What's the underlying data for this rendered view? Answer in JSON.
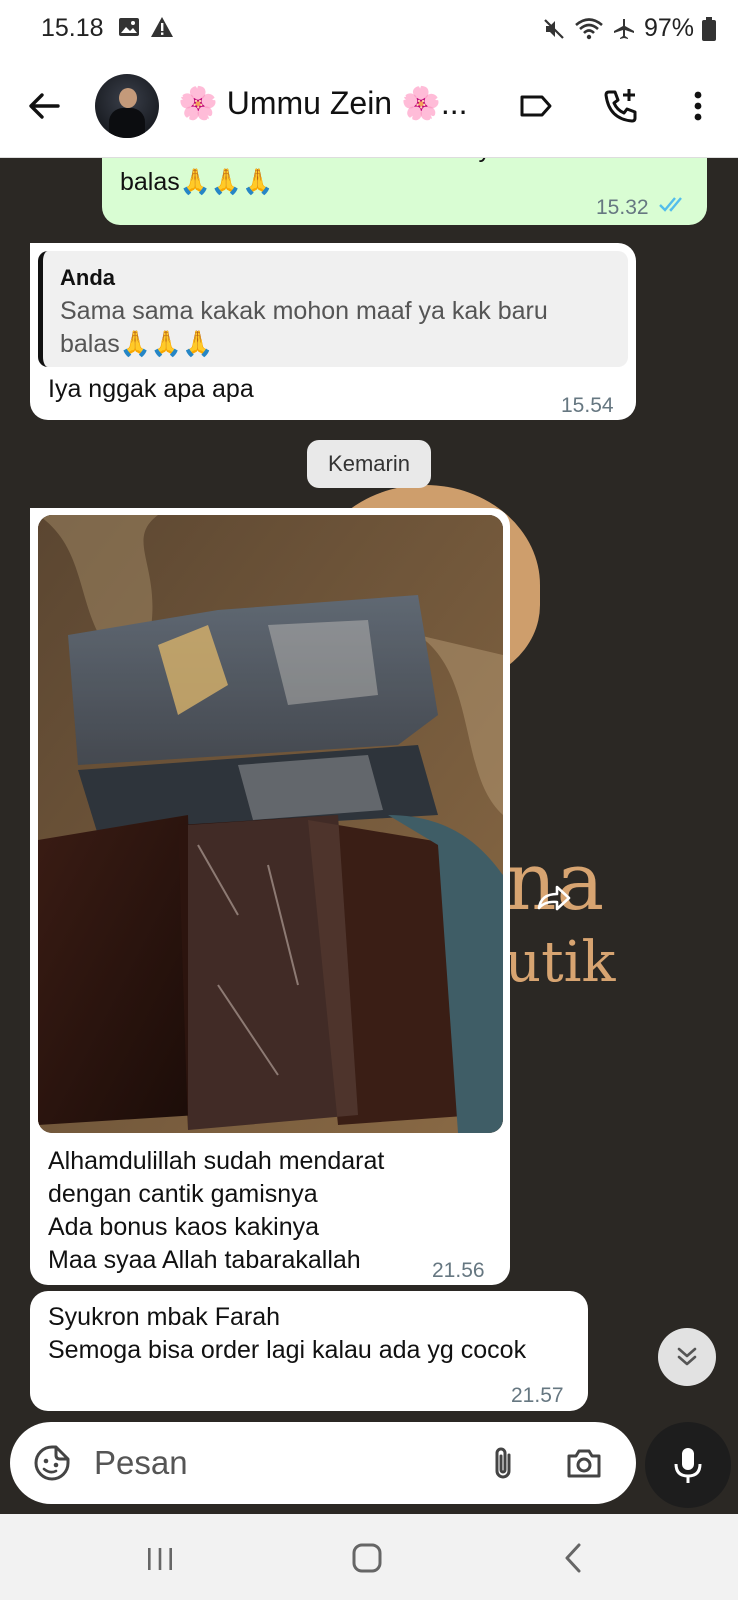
{
  "status_bar": {
    "time": "15.18",
    "battery": "97%"
  },
  "header": {
    "contact_name": "🌸 Ummu Zein 🌸..."
  },
  "messages": [
    {
      "direction": "out",
      "lines": [
        "Sama sama kakak mohon maaf ya kak baru",
        "balas🙏🙏🙏"
      ],
      "time": "15.32",
      "status": "read"
    },
    {
      "direction": "in",
      "quote_author": "Anda",
      "quote_lines": [
        "Sama sama kakak mohon maaf ya kak baru",
        "balas🙏🙏🙏"
      ],
      "text": "Iya nggak apa apa",
      "time": "15.54"
    },
    {
      "type": "date",
      "label": "Kemarin"
    },
    {
      "direction": "in",
      "has_image": true,
      "lines": [
        "Alhamdulillah sudah mendarat",
        "dengan cantik gamisnya",
        "Ada bonus kaos kakinya",
        "Maa syaa Allah tabarakallah"
      ],
      "time": "21.56"
    },
    {
      "direction": "in",
      "lines": [
        "Syukron mbak Farah",
        "Semoga bisa order lagi kalau ada yg cocok"
      ],
      "time": "21.57"
    }
  ],
  "wallpaper": {
    "text_1": "na",
    "text_2": "utik"
  },
  "composer": {
    "placeholder": "Pesan"
  },
  "colors": {
    "wallpaper_bg": "#2b2824",
    "outgoing_bubble": "#d9fdd3",
    "incoming_bubble": "#ffffff",
    "read_ticks": "#53bdeb",
    "wallpaper_accent": "#d7a471"
  },
  "icons": {
    "back": "arrow-left-icon",
    "label": "label-icon",
    "call": "add-call-icon",
    "menu": "more-vert-icon",
    "emoji": "sticker-icon",
    "attach": "paperclip-icon",
    "camera": "camera-icon",
    "mic": "mic-icon",
    "forward": "forward-icon",
    "scroll": "double-chevron-down-icon"
  }
}
